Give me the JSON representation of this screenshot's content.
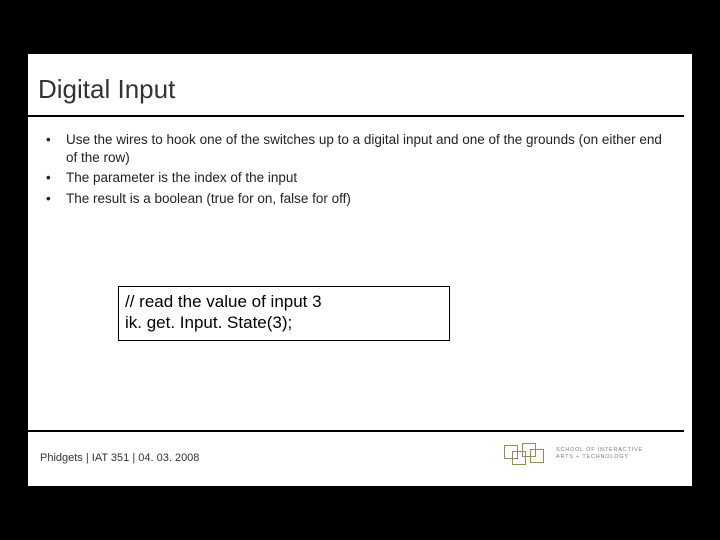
{
  "title": "Digital Input",
  "bullets": [
    "Use the wires to hook one of the switches up to a digital input and one of the grounds (on either end of the row)",
    "The parameter is the index of the input",
    "The result is a boolean (true for on, false for off)"
  ],
  "code": {
    "line1": "// read the value of input 3",
    "line2": " ik. get. Input. State(3);"
  },
  "footer": "Phidgets  |  IAT 351  |  04. 03. 2008",
  "logo": {
    "line1": "SCHOOL OF INTERACTIVE",
    "line2": "ARTS + TECHNOLOGY"
  }
}
